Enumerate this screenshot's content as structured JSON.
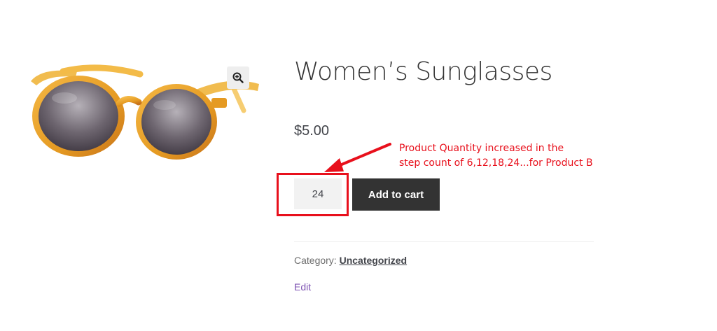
{
  "product": {
    "title": "Women’s Sunglasses",
    "price": "$5.00",
    "image_alt": "sunglasses-product-image",
    "zoom_icon": "zoom-in-icon"
  },
  "cart_form": {
    "quantity_value": "24",
    "add_to_cart_label": "Add to cart"
  },
  "annotation": {
    "line1": "Product Quantity increased in the",
    "line2": "step count of 6,12,18,24...for Product B",
    "color": "#e8101c"
  },
  "meta": {
    "category_label": "Category:",
    "category_value": "Uncategorized"
  },
  "edit_label": "Edit",
  "colors": {
    "button_bg": "#333333",
    "edit_link": "#7f54b3",
    "frame_amber": "#e8a12a"
  }
}
